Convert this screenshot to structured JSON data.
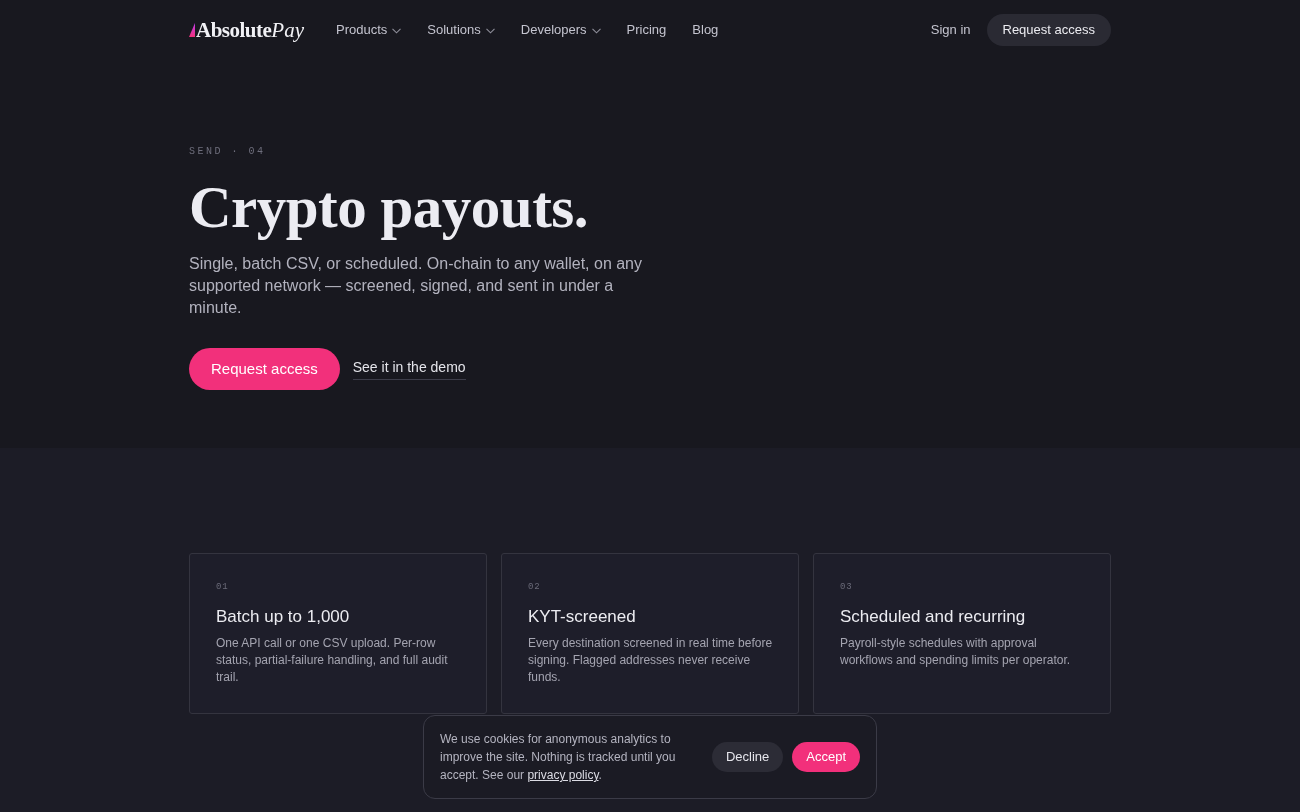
{
  "nav": {
    "logo": {
      "wordmark": "Absolute",
      "accent": "Pay"
    },
    "links": [
      {
        "label": "Products",
        "dropdown": true
      },
      {
        "label": "Solutions",
        "dropdown": true
      },
      {
        "label": "Developers",
        "dropdown": true
      },
      {
        "label": "Pricing",
        "dropdown": false
      },
      {
        "label": "Blog",
        "dropdown": false
      }
    ],
    "sign_in": "Sign in",
    "cta": "Request access"
  },
  "hero": {
    "eyebrow": "SEND · 04",
    "title": "Crypto payouts.",
    "lead": "Single, batch CSV, or scheduled. On-chain to any wallet, on any supported network — screened, signed, and sent in under a minute.",
    "primary_button": "Request access",
    "secondary_link": "See it in the demo"
  },
  "features": [
    {
      "number": "01",
      "title": "Batch up to 1,000",
      "description": "One API call or one CSV upload. Per-row status, partial-failure handling, and full audit trail."
    },
    {
      "number": "02",
      "title": "KYT-screened",
      "description": "Every destination screened in real time before signing. Flagged addresses never receive funds."
    },
    {
      "number": "03",
      "title": "Scheduled and recurring",
      "description": "Payroll-style schedules with approval workflows and spending limits per operator."
    }
  ],
  "cookie_banner": {
    "text_before": "We use cookies for anonymous analytics to improve the site. Nothing is tracked until you accept. See our ",
    "link": "privacy policy",
    "text_after": ".",
    "buttons": [
      {
        "label": "Decline",
        "kind": "secondary"
      },
      {
        "label": "Accept",
        "kind": "primary"
      }
    ]
  }
}
